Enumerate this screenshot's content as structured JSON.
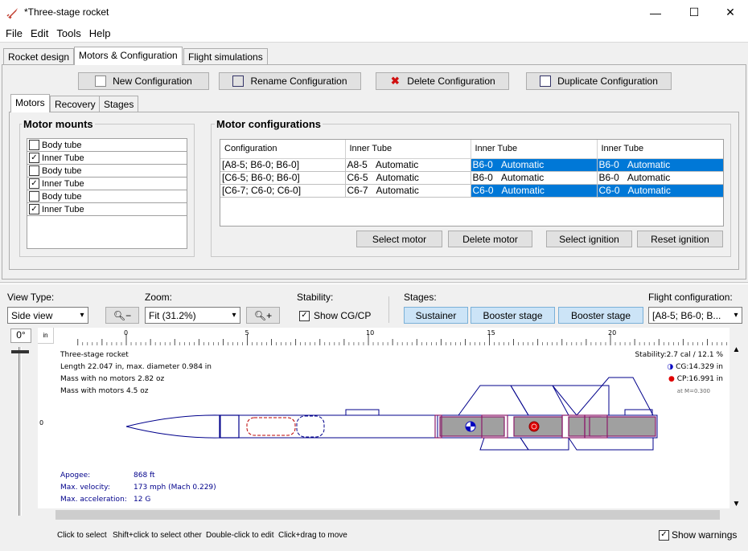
{
  "window": {
    "title": "*Three-stage rocket"
  },
  "menu": [
    "File",
    "Edit",
    "Tools",
    "Help"
  ],
  "main_tabs": [
    "Rocket design",
    "Motors & Configuration",
    "Flight simulations"
  ],
  "config_buttons": {
    "new": "New Configuration",
    "rename": "Rename Configuration",
    "delete": "Delete Configuration",
    "duplicate": "Duplicate Configuration"
  },
  "sub_tabs": [
    "Motors",
    "Recovery",
    "Stages"
  ],
  "motor_mounts": {
    "title": "Motor mounts",
    "items": [
      {
        "label": "Body tube",
        "checked": false
      },
      {
        "label": "Inner Tube",
        "checked": true
      },
      {
        "label": "Body tube",
        "checked": false
      },
      {
        "label": "Inner Tube",
        "checked": true
      },
      {
        "label": "Body tube",
        "checked": false
      },
      {
        "label": "Inner Tube",
        "checked": true
      }
    ]
  },
  "motor_configs": {
    "title": "Motor configurations",
    "headers": [
      "Configuration",
      "Inner Tube",
      "Inner Tube",
      "Inner Tube"
    ],
    "rows": [
      [
        "[A8-5; B6-0; B6-0]",
        "A8-5",
        "Automatic",
        "B6-0",
        "Automatic",
        "B6-0",
        "Automatic"
      ],
      [
        "[C6-5; B6-0; B6-0]",
        "C6-5",
        "Automatic",
        "B6-0",
        "Automatic",
        "B6-0",
        "Automatic"
      ],
      [
        "[C6-7; C6-0; C6-0]",
        "C6-7",
        "Automatic",
        "C6-0",
        "Automatic",
        "C6-0",
        "Automatic"
      ]
    ],
    "buttons": [
      "Select motor",
      "Delete motor",
      "Select ignition",
      "Reset ignition"
    ]
  },
  "view": {
    "view_type_label": "View Type:",
    "view_type_value": "Side view",
    "zoom_label": "Zoom:",
    "zoom_value": "Fit (31.2%)",
    "stability_label": "Stability:",
    "show_cgcp": "Show CG/CP",
    "stages_label": "Stages:",
    "stages": [
      "Sustainer",
      "Booster stage",
      "Booster stage"
    ],
    "flight_config_label": "Flight configuration:",
    "flight_config_value": "[A8-5; B6-0; B...",
    "rotation": "0°",
    "ruler_unit": "in",
    "ruler_ticks": [
      "0",
      "5",
      "10",
      "15",
      "20"
    ],
    "vertical_zero": "0"
  },
  "rocket_info": {
    "name": "Three-stage rocket",
    "length": "Length 22.047 in, max. diameter 0.984 in",
    "mass_no_motors": "Mass with no motors 2.82 oz",
    "mass_with_motors": "Mass with motors 4.5 oz",
    "stability": "Stability:2.7 cal / 12.1 %",
    "cg": "CG:14.329 in",
    "cp": "CP:16.991 in",
    "mach": "at M=0.300",
    "apogee_label": "Apogee:",
    "apogee_value": "868 ft",
    "velocity_label": "Max. velocity:",
    "velocity_value": "173 mph  (Mach 0.229)",
    "accel_label": "Max. acceleration:",
    "accel_value": "12 G"
  },
  "status": {
    "hints": [
      "Click to select",
      "Shift+click to select other",
      "Double-click to edit",
      "Click+drag to move"
    ],
    "show_warnings": "Show warnings"
  },
  "colors": {
    "selection": "#0078d7",
    "stage_button": "#cce4f7",
    "rocket_outline": "#00008b"
  }
}
